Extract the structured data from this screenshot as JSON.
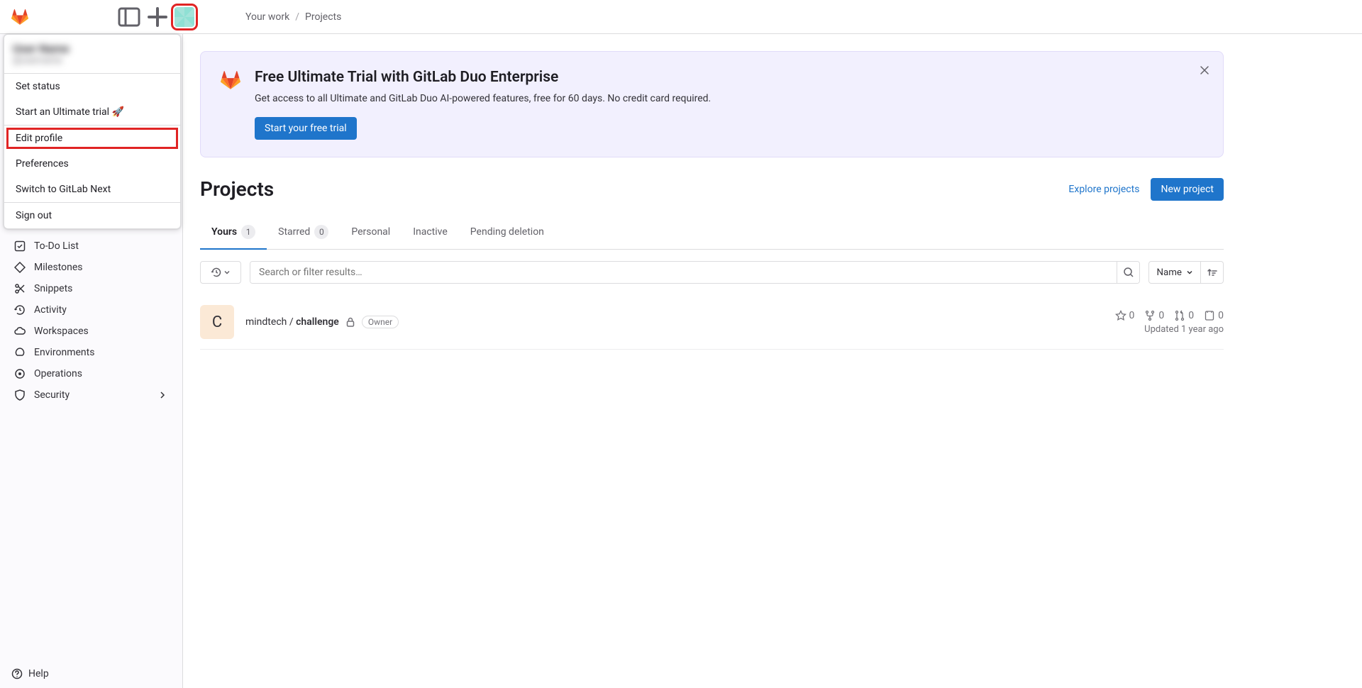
{
  "breadcrumb": {
    "root": "Your work",
    "current": "Projects"
  },
  "user_menu": {
    "name": "User Name",
    "handle": "@username",
    "set_status": "Set status",
    "start_trial": "Start an Ultimate trial 🚀",
    "edit_profile": "Edit profile",
    "preferences": "Preferences",
    "switch_next": "Switch to GitLab Next",
    "sign_out": "Sign out"
  },
  "sidebar": {
    "todo": "To-Do List",
    "milestones": "Milestones",
    "snippets": "Snippets",
    "activity": "Activity",
    "workspaces": "Workspaces",
    "environments": "Environments",
    "operations": "Operations",
    "security": "Security",
    "help": "Help"
  },
  "banner": {
    "title": "Free Ultimate Trial with GitLab Duo Enterprise",
    "text": "Get access to all Ultimate and GitLab Duo AI-powered features, free for 60 days. No credit card required.",
    "cta": "Start your free trial"
  },
  "page": {
    "title": "Projects",
    "explore": "Explore projects",
    "new": "New project"
  },
  "tabs": {
    "yours": "Yours",
    "yours_count": "1",
    "starred": "Starred",
    "starred_count": "0",
    "personal": "Personal",
    "inactive": "Inactive",
    "pending": "Pending deletion"
  },
  "filter": {
    "search_placeholder": "Search or filter results…",
    "sort_label": "Name"
  },
  "project": {
    "avatar_letter": "C",
    "path": "mindtech / ",
    "name": "challenge",
    "role": "Owner",
    "stars": "0",
    "forks": "0",
    "mrs": "0",
    "issues": "0",
    "updated": "Updated 1 year ago"
  }
}
